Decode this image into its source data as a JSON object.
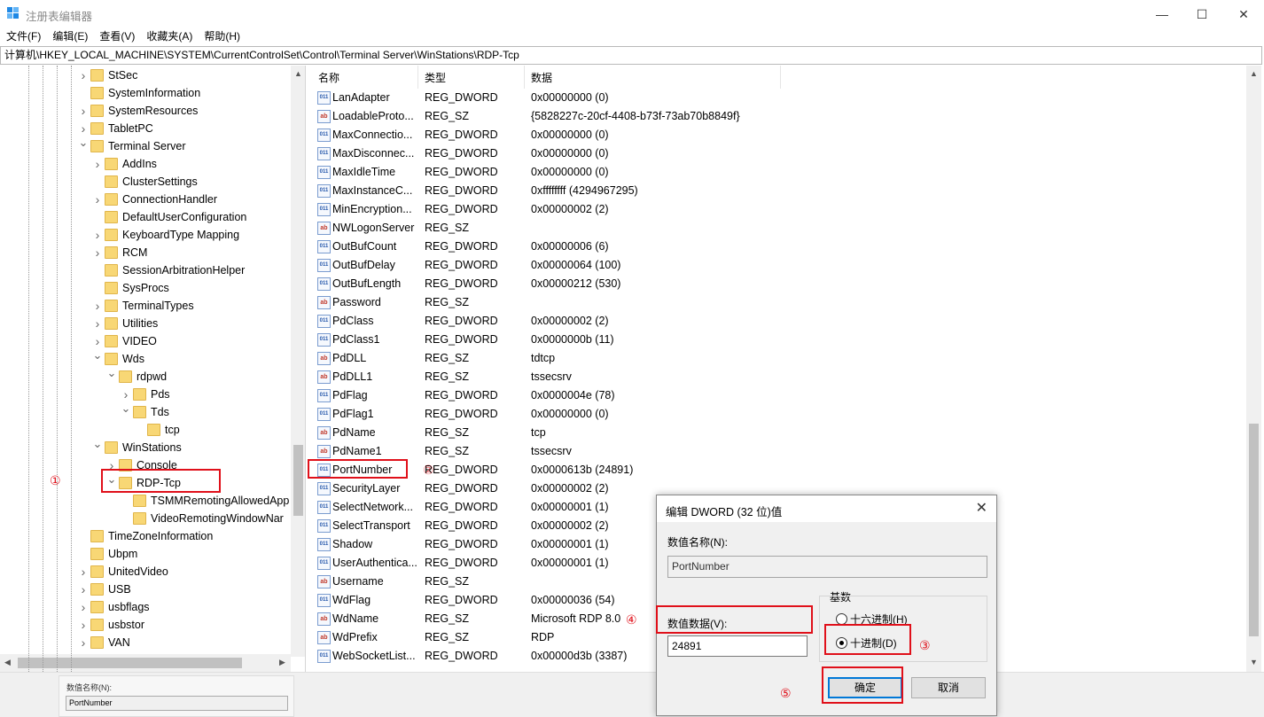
{
  "window": {
    "title": "注册表编辑器",
    "minimize": "—",
    "maximize": "☐",
    "close": "✕"
  },
  "menu": [
    "文件(F)",
    "编辑(E)",
    "查看(V)",
    "收藏夹(A)",
    "帮助(H)"
  ],
  "address": "计算机\\HKEY_LOCAL_MACHINE\\SYSTEM\\CurrentControlSet\\Control\\Terminal Server\\WinStations\\RDP-Tcp",
  "tree": {
    "items": [
      {
        "label": "StSec",
        "expanded": false
      },
      {
        "label": "SystemInformation",
        "expanded": null
      },
      {
        "label": "SystemResources",
        "expanded": false
      },
      {
        "label": "TabletPC",
        "expanded": false
      },
      {
        "label": "Terminal Server",
        "expanded": true
      },
      {
        "label": "AddIns",
        "expanded": false
      },
      {
        "label": "ClusterSettings",
        "expanded": null
      },
      {
        "label": "ConnectionHandler",
        "expanded": false
      },
      {
        "label": "DefaultUserConfiguration",
        "expanded": null
      },
      {
        "label": "KeyboardType Mapping",
        "expanded": false
      },
      {
        "label": "RCM",
        "expanded": false
      },
      {
        "label": "SessionArbitrationHelper",
        "expanded": null
      },
      {
        "label": "SysProcs",
        "expanded": null
      },
      {
        "label": "TerminalTypes",
        "expanded": false
      },
      {
        "label": "Utilities",
        "expanded": false
      },
      {
        "label": "VIDEO",
        "expanded": false
      },
      {
        "label": "Wds",
        "expanded": true
      },
      {
        "label": "rdpwd",
        "expanded": true
      },
      {
        "label": "Pds",
        "expanded": false
      },
      {
        "label": "Tds",
        "expanded": true
      },
      {
        "label": "tcp",
        "expanded": null
      },
      {
        "label": "WinStations",
        "expanded": true
      },
      {
        "label": "Console",
        "expanded": false
      },
      {
        "label": "RDP-Tcp",
        "expanded": true
      },
      {
        "label": "TSMMRemotingAllowedApp",
        "expanded": null
      },
      {
        "label": "VideoRemotingWindowNar",
        "expanded": null
      },
      {
        "label": "TimeZoneInformation",
        "expanded": null
      },
      {
        "label": "Ubpm",
        "expanded": null
      },
      {
        "label": "UnitedVideo",
        "expanded": false
      },
      {
        "label": "USB",
        "expanded": false
      },
      {
        "label": "usbflags",
        "expanded": false
      },
      {
        "label": "usbstor",
        "expanded": false
      },
      {
        "label": "VAN",
        "expanded": false
      }
    ]
  },
  "list": {
    "columns": {
      "name": "名称",
      "type": "类型",
      "data": "数据"
    },
    "rows": [
      {
        "icon": "binary-value-icon",
        "name": "LanAdapter",
        "type": "REG_DWORD",
        "data": "0x00000000 (0)"
      },
      {
        "icon": "string-value-icon",
        "name": "LoadableProto...",
        "type": "REG_SZ",
        "data": "{5828227c-20cf-4408-b73f-73ab70b8849f}"
      },
      {
        "icon": "binary-value-icon",
        "name": "MaxConnectio...",
        "type": "REG_DWORD",
        "data": "0x00000000 (0)"
      },
      {
        "icon": "binary-value-icon",
        "name": "MaxDisconnec...",
        "type": "REG_DWORD",
        "data": "0x00000000 (0)"
      },
      {
        "icon": "binary-value-icon",
        "name": "MaxIdleTime",
        "type": "REG_DWORD",
        "data": "0x00000000 (0)"
      },
      {
        "icon": "binary-value-icon",
        "name": "MaxInstanceC...",
        "type": "REG_DWORD",
        "data": "0xffffffff (4294967295)"
      },
      {
        "icon": "binary-value-icon",
        "name": "MinEncryption...",
        "type": "REG_DWORD",
        "data": "0x00000002 (2)"
      },
      {
        "icon": "string-value-icon",
        "name": "NWLogonServer",
        "type": "REG_SZ",
        "data": ""
      },
      {
        "icon": "binary-value-icon",
        "name": "OutBufCount",
        "type": "REG_DWORD",
        "data": "0x00000006 (6)"
      },
      {
        "icon": "binary-value-icon",
        "name": "OutBufDelay",
        "type": "REG_DWORD",
        "data": "0x00000064 (100)"
      },
      {
        "icon": "binary-value-icon",
        "name": "OutBufLength",
        "type": "REG_DWORD",
        "data": "0x00000212 (530)"
      },
      {
        "icon": "string-value-icon",
        "name": "Password",
        "type": "REG_SZ",
        "data": ""
      },
      {
        "icon": "binary-value-icon",
        "name": "PdClass",
        "type": "REG_DWORD",
        "data": "0x00000002 (2)"
      },
      {
        "icon": "binary-value-icon",
        "name": "PdClass1",
        "type": "REG_DWORD",
        "data": "0x0000000b (11)"
      },
      {
        "icon": "string-value-icon",
        "name": "PdDLL",
        "type": "REG_SZ",
        "data": "tdtcp"
      },
      {
        "icon": "string-value-icon",
        "name": "PdDLL1",
        "type": "REG_SZ",
        "data": "tssecsrv"
      },
      {
        "icon": "binary-value-icon",
        "name": "PdFlag",
        "type": "REG_DWORD",
        "data": "0x0000004e (78)"
      },
      {
        "icon": "binary-value-icon",
        "name": "PdFlag1",
        "type": "REG_DWORD",
        "data": "0x00000000 (0)"
      },
      {
        "icon": "string-value-icon",
        "name": "PdName",
        "type": "REG_SZ",
        "data": "tcp"
      },
      {
        "icon": "string-value-icon",
        "name": "PdName1",
        "type": "REG_SZ",
        "data": "tssecsrv"
      },
      {
        "icon": "binary-value-icon",
        "name": "PortNumber",
        "type": "REG_DWORD",
        "data": "0x0000613b (24891)"
      },
      {
        "icon": "binary-value-icon",
        "name": "SecurityLayer",
        "type": "REG_DWORD",
        "data": "0x00000002 (2)"
      },
      {
        "icon": "binary-value-icon",
        "name": "SelectNetwork...",
        "type": "REG_DWORD",
        "data": "0x00000001 (1)"
      },
      {
        "icon": "binary-value-icon",
        "name": "SelectTransport",
        "type": "REG_DWORD",
        "data": "0x00000002 (2)"
      },
      {
        "icon": "binary-value-icon",
        "name": "Shadow",
        "type": "REG_DWORD",
        "data": "0x00000001 (1)"
      },
      {
        "icon": "binary-value-icon",
        "name": "UserAuthentica...",
        "type": "REG_DWORD",
        "data": "0x00000001 (1)"
      },
      {
        "icon": "string-value-icon",
        "name": "Username",
        "type": "REG_SZ",
        "data": ""
      },
      {
        "icon": "binary-value-icon",
        "name": "WdFlag",
        "type": "REG_DWORD",
        "data": "0x00000036 (54)"
      },
      {
        "icon": "string-value-icon",
        "name": "WdName",
        "type": "REG_SZ",
        "data": "Microsoft RDP 8.0"
      },
      {
        "icon": "string-value-icon",
        "name": "WdPrefix",
        "type": "REG_SZ",
        "data": "RDP"
      },
      {
        "icon": "binary-value-icon",
        "name": "WebSocketList...",
        "type": "REG_DWORD",
        "data": "0x00000d3b (3387)"
      }
    ]
  },
  "dialog": {
    "title": "编辑 DWORD (32 位)值",
    "close": "✕",
    "name_label": "数值名称(N):",
    "name_value": "PortNumber",
    "data_label": "数值数据(V):",
    "data_value": "24891",
    "base_label": "基数",
    "hex_label": "十六进制(H)",
    "dec_label": "十进制(D)",
    "base_selected": "decimal",
    "ok": "确定",
    "cancel": "取消"
  },
  "ghost": {
    "label": "数值名称(N):",
    "value": "PortNumber"
  },
  "annotations": {
    "m1": "①",
    "m2": "②",
    "m3": "③",
    "m4": "④",
    "m5": "⑤",
    "color": "#e0101a"
  },
  "icons": {
    "string_glyph": "ab",
    "binary_glyph": "011"
  }
}
